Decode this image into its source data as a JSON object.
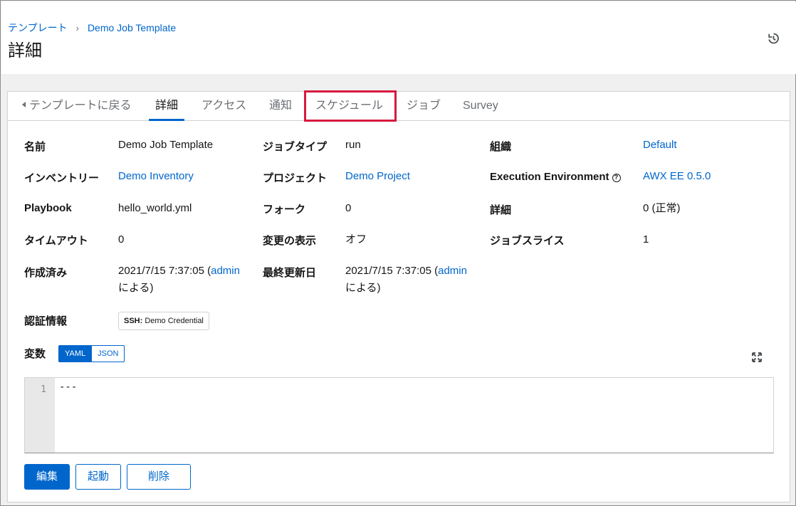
{
  "breadcrumb": {
    "root": "テンプレート",
    "current": "Demo Job Template"
  },
  "page_title": "詳細",
  "tabs": [
    {
      "label": "テンプレートに戻る"
    },
    {
      "label": "詳細"
    },
    {
      "label": "アクセス"
    },
    {
      "label": "通知"
    },
    {
      "label": "スケジュール"
    },
    {
      "label": "ジョブ"
    },
    {
      "label": "Survey"
    }
  ],
  "active_tab": "詳細",
  "highlighted_tab": "スケジュール",
  "details": {
    "name": {
      "label": "名前",
      "value": "Demo Job Template"
    },
    "job_type": {
      "label": "ジョブタイプ",
      "value": "run"
    },
    "organization": {
      "label": "組織",
      "value": "Default"
    },
    "inventory": {
      "label": "インベントリー",
      "value": "Demo Inventory"
    },
    "project": {
      "label": "プロジェクト",
      "value": "Demo Project"
    },
    "ee": {
      "label": "Execution Environment",
      "value": "AWX EE 0.5.0"
    },
    "playbook": {
      "label": "Playbook",
      "value": "hello_world.yml"
    },
    "forks": {
      "label": "フォーク",
      "value": "0"
    },
    "verbosity": {
      "label": "詳細",
      "value": "0 (正常)"
    },
    "timeout": {
      "label": "タイムアウト",
      "value": "0"
    },
    "show_changes": {
      "label": "変更の表示",
      "value": "オフ"
    },
    "job_slice": {
      "label": "ジョブスライス",
      "value": "1"
    },
    "created": {
      "label": "作成済み",
      "date": "2021/7/15 7:37:05 (",
      "user": "admin",
      "suffix": "による)"
    },
    "modified": {
      "label": "最終更新日",
      "date": "2021/7/15 7:37:05 (",
      "user": "admin",
      "suffix": "による)"
    },
    "credentials": {
      "label": "認証情報",
      "chip_kind": "SSH:",
      "chip_name": " Demo Credential"
    }
  },
  "variables": {
    "label": "変数",
    "yaml": "YAML",
    "json": "JSON",
    "mode": "YAML",
    "line_number": "1",
    "content": "---"
  },
  "buttons": {
    "edit": "編集",
    "launch": "起動",
    "delete": "削除"
  },
  "colors": {
    "accent": "#0066cc",
    "highlight": "#d7193f"
  }
}
